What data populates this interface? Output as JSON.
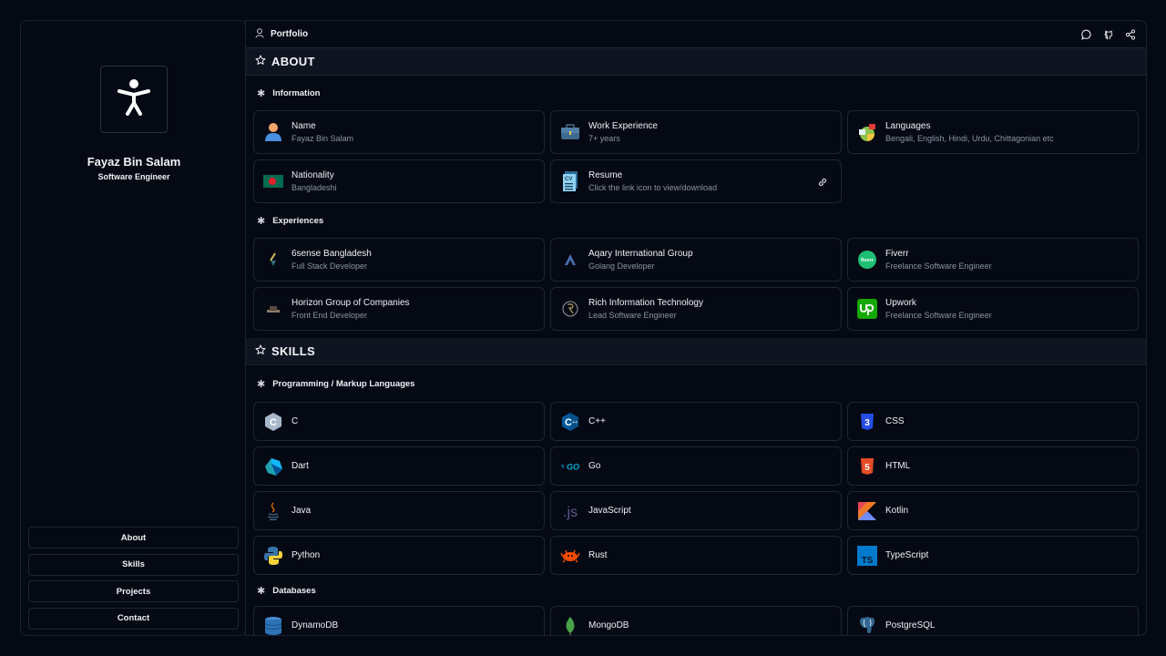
{
  "sidebar": {
    "avatar_icon": "accessibility-person-icon",
    "name": "Fayaz Bin Salam",
    "role": "Software Engineer",
    "nav": [
      {
        "label": "About"
      },
      {
        "label": "Skills"
      },
      {
        "label": "Projects"
      },
      {
        "label": "Contact"
      }
    ]
  },
  "topbar": {
    "icon": "user-icon",
    "title": "Portfolio",
    "actions": [
      "chat-icon",
      "github-icon",
      "share-icon"
    ]
  },
  "about": {
    "title": "ABOUT",
    "information": {
      "title": "Information",
      "items": [
        {
          "title": "Name",
          "subtitle": "Fayaz Bin Salam",
          "icon": "person-icon"
        },
        {
          "title": "Work Experience",
          "subtitle": "7+ years",
          "icon": "briefcase-icon"
        },
        {
          "title": "Languages",
          "subtitle": "Bengali, English, Hindi, Urdu, Chittagonian etc",
          "icon": "languages-icon"
        },
        {
          "title": "Nationality",
          "subtitle": "Bangladeshi",
          "icon": "bangladesh-flag-icon"
        },
        {
          "title": "Resume",
          "subtitle": "Click the link icon to view/download",
          "icon": "cv-document-icon",
          "action_icon": "link-icon"
        }
      ]
    },
    "experiences": {
      "title": "Experiences",
      "items": [
        {
          "title": "6sense Bangladesh",
          "subtitle": "Full Stack Developer",
          "icon": "6sense-logo-icon"
        },
        {
          "title": "Aqary International Group",
          "subtitle": "Golang Developer",
          "icon": "aqary-logo-icon"
        },
        {
          "title": "Fiverr",
          "subtitle": "Freelance Software Engineer",
          "icon": "fiverr-logo-icon"
        },
        {
          "title": "Horizon Group of Companies",
          "subtitle": "Front End Developer",
          "icon": "horizon-logo-icon"
        },
        {
          "title": "Rich Information Technology",
          "subtitle": "Lead Software Engineer",
          "icon": "rich-it-logo-icon"
        },
        {
          "title": "Upwork",
          "subtitle": "Freelance Software Engineer",
          "icon": "upwork-logo-icon"
        }
      ]
    }
  },
  "skills": {
    "title": "SKILLS",
    "languages": {
      "title": "Programming / Markup Languages",
      "items": [
        {
          "label": "C",
          "icon": "c-logo-icon"
        },
        {
          "label": "C++",
          "icon": "cpp-logo-icon"
        },
        {
          "label": "CSS",
          "icon": "css3-logo-icon"
        },
        {
          "label": "Dart",
          "icon": "dart-logo-icon"
        },
        {
          "label": "Go",
          "icon": "go-logo-icon"
        },
        {
          "label": "HTML",
          "icon": "html5-logo-icon"
        },
        {
          "label": "Java",
          "icon": "java-logo-icon"
        },
        {
          "label": "JavaScript",
          "icon": "javascript-logo-icon"
        },
        {
          "label": "Kotlin",
          "icon": "kotlin-logo-icon"
        },
        {
          "label": "Python",
          "icon": "python-logo-icon"
        },
        {
          "label": "Rust",
          "icon": "rust-logo-icon"
        },
        {
          "label": "TypeScript",
          "icon": "typescript-logo-icon"
        }
      ]
    },
    "databases": {
      "title": "Databases",
      "items": [
        {
          "label": "DynamoDB",
          "icon": "dynamodb-logo-icon"
        },
        {
          "label": "MongoDB",
          "icon": "mongodb-logo-icon"
        },
        {
          "label": "PostgreSQL",
          "icon": "postgresql-logo-icon"
        }
      ]
    }
  },
  "colors": {
    "background": "#050913",
    "section_header": "#0f1421",
    "border": "#1f2533",
    "muted_text": "#8b93a4"
  }
}
